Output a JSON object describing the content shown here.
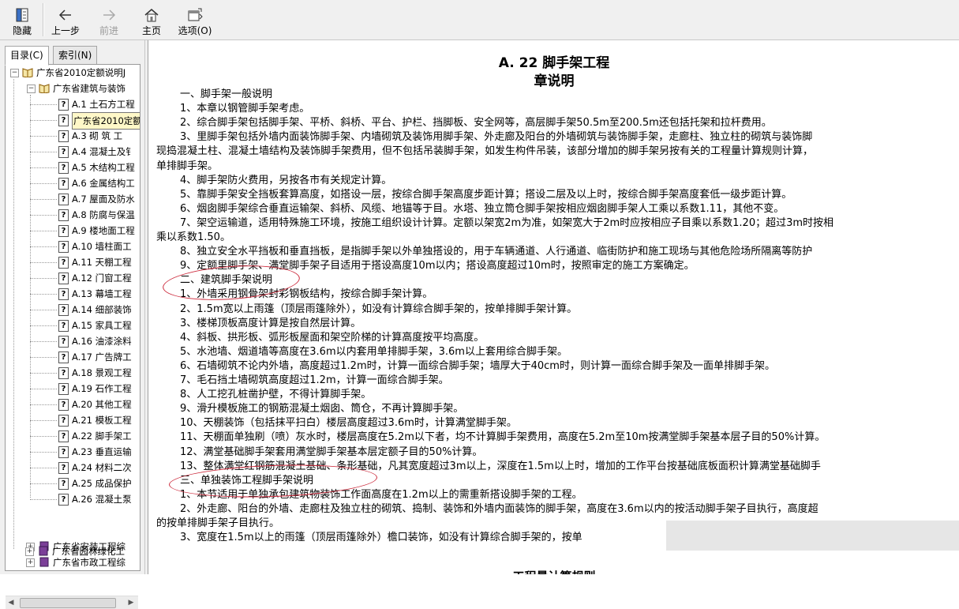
{
  "toolbar": {
    "buttons": [
      {
        "label": "隐藏",
        "icon": "hide-pane-icon",
        "enabled": true
      },
      {
        "label": "上一步",
        "icon": "back-arrow-icon",
        "enabled": true
      },
      {
        "label": "前进",
        "icon": "forward-arrow-icon",
        "enabled": false
      },
      {
        "label": "主页",
        "icon": "home-icon",
        "enabled": true
      },
      {
        "label": "选项(O)",
        "icon": "options-icon",
        "enabled": true
      }
    ]
  },
  "tabs": {
    "contents": "目录(C)",
    "index": "索引(N)"
  },
  "tree": {
    "root": "广东省2010定额说明J",
    "group1": "广东省建筑与装饰",
    "items": [
      "A.1  土石方工程",
      "广东省2010定额",
      "A.3  砌 筑 工",
      "A.4  混凝土及钅",
      "A.5  木结构工程",
      "A.6  金属结构工",
      "A.7  屋面及防水",
      "A.8  防腐与保温",
      "A.9  楼地面工程",
      "A.10  墙柱面工",
      "A.11  天棚工程",
      "A.12  门窗工程",
      "A.13  幕墙工程",
      "A.14  细部装饰",
      "A.15  家具工程",
      "A.16  油漆涂料",
      "A.17  广告牌工",
      "A.18  景观工程",
      "A.19  石作工程",
      "A.20  其他工程",
      "A.21  模板工程",
      "A.22  脚手架工",
      "A.23  垂直运输",
      "A.24  材料二次",
      "A.25  成品保护",
      "A.26  混凝土泵"
    ],
    "groups_bottom": [
      "广东省安装工程综",
      "广东省市政工程综",
      "广东省园林绿化工"
    ]
  },
  "document": {
    "title": "A. 22   脚手架工程",
    "subtitle": "章说明",
    "lines": [
      "一、脚手架一般说明",
      "1、本章以钢管脚手架考虑。",
      "2、综合脚手架包括脚手架、平桥、斜桥、平台、护栏、挡脚板、安全网等，高层脚手架50.5m至200.5m还包括托架和拉杆费用。",
      "3、里脚手架包括外墙内面装饰脚手架、内墙砌筑及装饰用脚手架、外走廊及阳台的外墙砌筑与装饰脚手架，走廊柱、独立柱的砌筑与装饰脚",
      "现捣混凝土柱、混凝土墙结构及装饰脚手架费用，但不包括吊装脚手架，如发生构件吊装，该部分增加的脚手架另按有关的工程量计算规则计算，",
      "单排脚手架。",
      "4、脚手架防火费用，另按各市有关规定计算。",
      "5、靠脚手架安全挡板套算高度，如搭设一层，按综合脚手架高度步距计算；搭设二层及以上时，按综合脚手架高度套低一级步距计算。",
      "6、烟囱脚手架综合垂直运输架、斜桥、风缆、地锚等于目。水塔、独立筒仓脚手架按相应烟囱脚手架人工乘以系数1.11，其他不变。",
      "7、架空运输道，适用特殊施工环境，按施工组织设计计算。定额以架宽2m为准，如架宽大于2m时应按相应子目乘以系数1.20；超过3m时按相",
      "乘以系数1.50。",
      "8、独立安全水平挡板和垂直挡板，是指脚手架以外单独搭设的，用于车辆通道、人行通道、临街防护和施工现场与其他危险场所隔离等防护",
      "9、定额里脚手架、满堂脚手架子目适用于搭设高度10m以内；搭设高度超过10m时，按照审定的施工方案确定。",
      "二、建筑脚手架说明",
      "1、外墙采用钢骨架封彩钢板结构，按综合脚手架计算。",
      "2、1.5m宽以上雨篷（顶层雨篷除外），如没有计算综合脚手架的，按单排脚手架计算。",
      "3、楼梯顶板高度计算是按自然层计算。",
      "4、斜板、拱形板、弧形板屋面和架空阶梯的计算高度按平均高度。",
      "5、水池墙、烟道墙等高度在3.6m以内套用单排脚手架，3.6m以上套用综合脚手架。",
      "6、石墙砌筑不论内外墙，高度超过1.2m时，计算一面综合脚手架；墙厚大于40cm时，则计算一面综合脚手架及一面单排脚手架。",
      "7、毛石挡土墙砌筑高度超过1.2m，计算一面综合脚手架。",
      "8、人工挖孔桩凿护壁，不得计算脚手架。",
      "9、滑升模板施工的钢筋混凝土烟囱、筒仓，不再计算脚手架。",
      "10、天棚装饰（包括抹平扫白）楼层高度超过3.6m时，计算满堂脚手架。",
      "11、天棚面单独刷（喷）灰水时，楼层高度在5.2m以下者，均不计算脚手架费用，高度在5.2m至10m按满堂脚手架基本层子目的50%计算。",
      "12、满堂基础脚手架套用满堂脚手架基本层定额子目的50%计算。",
      "13、整体满堂红钢筋混凝土基础、条形基础，凡其宽度超过3m以上，深度在1.5m以上时，增加的工作平台按基础底板面积计算满堂基础脚手",
      "三、单独装饰工程脚手架说明",
      "1、本节适用于单独承包建筑物装饰工作面高度在1.2m以上的需重新搭设脚手架的工程。",
      "2、外走廊、阳台的外墙、走廊柱及独立柱的砌筑、捣制、装饰和外墙内面装饰的脚手架，高度在3.6m以内的按活动脚手架子目执行，高度超",
      "的按单排脚手架子目执行。",
      "3、宽度在1.5m以上的雨篷（顶层雨篷除外）檐口装饰，如没有计算综合脚手架的，按单"
    ],
    "footer_partial": "工程量计算规则"
  },
  "colors": {
    "annotation_circle": "#cc2a3c"
  }
}
